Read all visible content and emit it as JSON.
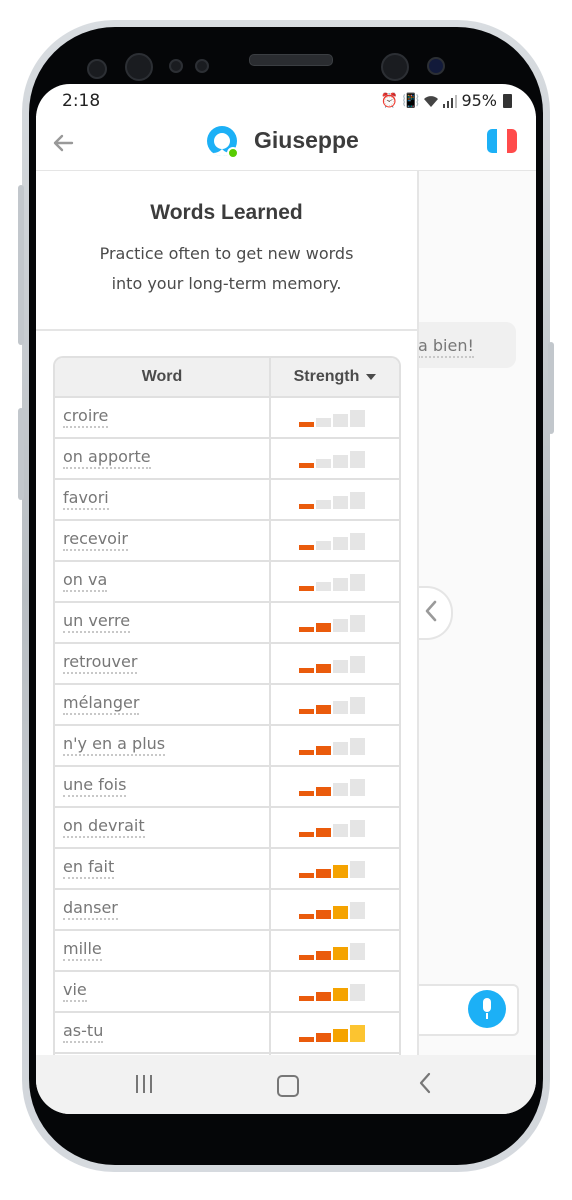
{
  "status_bar": {
    "time": "2:18",
    "icons": [
      "alarm-icon",
      "vibrate-icon",
      "wifi-icon",
      "signal-icon"
    ],
    "battery": "95%"
  },
  "header": {
    "back_icon": "back-arrow-icon",
    "title": "Giuseppe",
    "flag_icon": "french-flag-icon",
    "flag_colors": [
      "#1cb0f6",
      "#ffffff",
      "#ff4b4b"
    ]
  },
  "panel": {
    "title": "Words Learned",
    "subtitle_line1": "Practice often to get new words",
    "subtitle_line2": "into your long-term memory."
  },
  "table": {
    "columns": [
      "Word",
      "Strength"
    ],
    "rows": [
      {
        "word": "croire",
        "strength": 1
      },
      {
        "word": "on apporte",
        "strength": 1
      },
      {
        "word": "favori",
        "strength": 1
      },
      {
        "word": "recevoir",
        "strength": 1
      },
      {
        "word": "on va",
        "strength": 1
      },
      {
        "word": "un verre",
        "strength": 2
      },
      {
        "word": "retrouver",
        "strength": 2
      },
      {
        "word": "mélanger",
        "strength": 2
      },
      {
        "word": "n'y en a plus",
        "strength": 2
      },
      {
        "word": "une fois",
        "strength": 2
      },
      {
        "word": "on devrait",
        "strength": 2
      },
      {
        "word": "en fait",
        "strength": 3
      },
      {
        "word": "danser",
        "strength": 3
      },
      {
        "word": "mille",
        "strength": 3
      },
      {
        "word": "vie",
        "strength": 3
      },
      {
        "word": "as-tu",
        "strength": 4
      },
      {
        "word": "",
        "strength": 0
      }
    ]
  },
  "chat": {
    "bubble_text": "a bien!",
    "collapse_icon": "chevron-left-icon",
    "mic_icon": "microphone-icon"
  },
  "colors": {
    "bar_colors": [
      "#ea5b0c",
      "#ea5b0c",
      "#f5a300",
      "#fcc430"
    ],
    "bar_empty": "#e5e5e5",
    "accent": "#1cb0f6"
  },
  "nav_bar": {
    "icons": [
      "recent-apps-icon",
      "home-icon",
      "system-back-icon"
    ]
  }
}
